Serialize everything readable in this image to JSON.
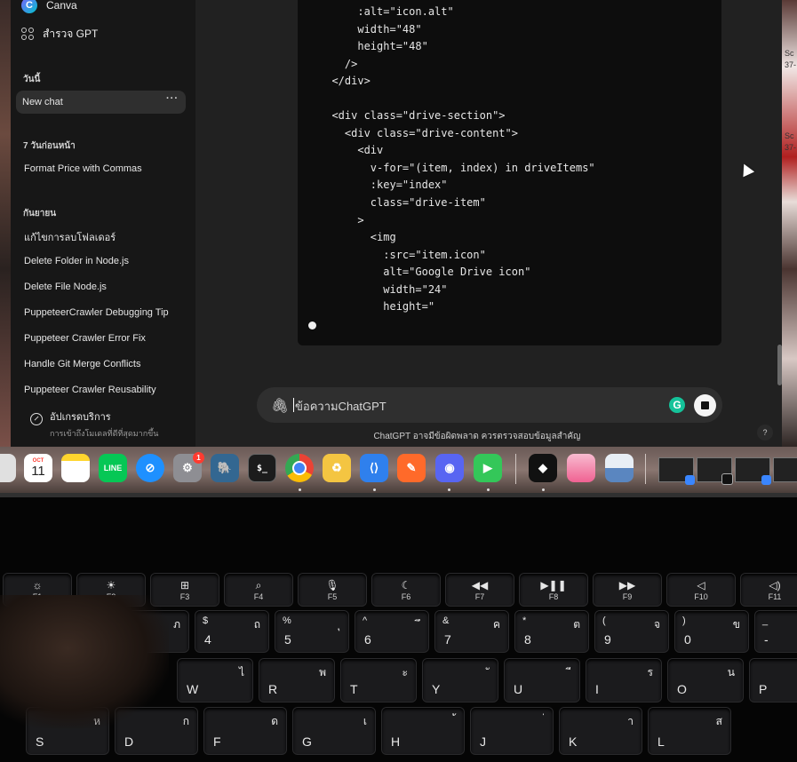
{
  "sidebar": {
    "top_items": [
      {
        "label": "Canva",
        "icon": "canva-logo-icon"
      },
      {
        "label": "สำรวจ GPT",
        "icon": "grid-icon"
      }
    ],
    "sections": [
      {
        "header": "วันนี้",
        "items": [
          "New chat"
        ]
      },
      {
        "header": "7 วันก่อนหน้า",
        "items": [
          "Format Price with Commas"
        ]
      },
      {
        "header": "กันยายน",
        "items": [
          "แก้ไขการลบโฟลเดอร์",
          "Delete Folder in Node.js",
          "Delete File Node.js",
          "PuppeteerCrawler Debugging Tip",
          "Puppeteer Crawler Error Fix",
          "Handle Git Merge Conflicts",
          "Puppeteer Crawler Reusability"
        ]
      }
    ],
    "more_label": "···",
    "upgrade": {
      "title": "อัปเกรดบริการ",
      "subtitle": "การเข้าถึงโมเดลที่ดีที่สุดมากขึ้น"
    }
  },
  "code_block": {
    "lines": [
      "      :alt=\"icon.alt\"",
      "      width=\"48\"",
      "      height=\"48\"",
      "    />",
      "  </div>",
      "",
      "  <div class=\"drive-section\">",
      "    <div class=\"drive-content\">",
      "      <div",
      "        v-for=\"(item, index) in driveItems\"",
      "        :key=\"index\"",
      "        class=\"drive-item\"",
      "      >",
      "        <img",
      "          :src=\"item.icon\"",
      "          alt=\"Google Drive icon\"",
      "          width=\"24\"",
      "          height=\""
    ]
  },
  "composer": {
    "placeholder": "ข้อความChatGPT",
    "attach_icon": "paperclip-icon",
    "grammarly_icon": "grammarly-icon",
    "stop_icon": "stop-icon"
  },
  "disclaimer": "ChatGPT อาจมีข้อผิดพลาด ควรตรวจสอบข้อมูลสำคัญ",
  "help_label": "?",
  "wallpaper_text": [
    "Sc",
    "37-",
    "Sc",
    "37-"
  ],
  "dock": {
    "apps": [
      {
        "name": "launchpad",
        "label": "",
        "color": "#e0e0e0"
      },
      {
        "name": "calendar",
        "label": "11",
        "month": "OCT",
        "color": "#ffffff"
      },
      {
        "name": "notes",
        "label": "",
        "color": "#ffd52e"
      },
      {
        "name": "line",
        "label": "LINE",
        "color": "#06c755"
      },
      {
        "name": "safari",
        "label": "⊘",
        "color": "#1e90ff"
      },
      {
        "name": "system-settings",
        "label": "⚙",
        "color": "#8e8e93",
        "badge": "1"
      },
      {
        "name": "postgres",
        "label": "🐘",
        "color": "#336791"
      },
      {
        "name": "terminal",
        "label": "$_",
        "color": "#1c1c1c"
      },
      {
        "name": "chrome",
        "label": "",
        "color": "#ffffff"
      },
      {
        "name": "recycle",
        "label": "♻",
        "color": "#f4c542"
      },
      {
        "name": "vscode",
        "label": "⟨⟩",
        "color": "#2f80ed"
      },
      {
        "name": "pen-tool",
        "label": "✎",
        "color": "#ff6a2a"
      },
      {
        "name": "discord",
        "label": "◉",
        "color": "#5865f2"
      },
      {
        "name": "facetime",
        "label": "▶",
        "color": "#34c759"
      },
      {
        "name": "unity",
        "label": "◆",
        "color": "#111111"
      },
      {
        "name": "photos",
        "label": "",
        "color": "#f06292"
      },
      {
        "name": "preview",
        "label": "",
        "color": "#e8eef5"
      }
    ]
  },
  "keyboard": {
    "fn_row": [
      {
        "icon": "☼",
        "label": "F1"
      },
      {
        "icon": "☀",
        "label": "F2"
      },
      {
        "icon": "⊞",
        "label": "F3"
      },
      {
        "icon": "⌕",
        "label": "F4"
      },
      {
        "icon": "🎙",
        "label": "F5"
      },
      {
        "icon": "☾",
        "label": "F6"
      },
      {
        "icon": "◀◀",
        "label": "F7"
      },
      {
        "icon": "▶❚❚",
        "label": "F8"
      },
      {
        "icon": "▶▶",
        "label": "F9"
      },
      {
        "icon": "◁",
        "label": "F10"
      },
      {
        "icon": "◁)",
        "label": "F11"
      }
    ],
    "number_row": [
      {
        "top": "#",
        "main": "3",
        "thai": "ภ"
      },
      {
        "top": "$",
        "main": "4",
        "thai": "ถ"
      },
      {
        "top": "%",
        "main": "5",
        "thai": "ุ"
      },
      {
        "top": "^",
        "main": "6",
        "thai": "ึ"
      },
      {
        "top": "&",
        "main": "7",
        "thai": "ค"
      },
      {
        "top": "*",
        "main": "8",
        "thai": "ต"
      },
      {
        "top": "(",
        "main": "9",
        "thai": "จ"
      },
      {
        "top": ")",
        "main": "0",
        "thai": "ข"
      },
      {
        "top": "_",
        "main": "-",
        "thai": "ช"
      }
    ],
    "q_row": [
      {
        "main": "W",
        "thai": "ไ"
      },
      {
        "main": "R",
        "thai": "พ"
      },
      {
        "main": "T",
        "thai": "ะ"
      },
      {
        "main": "Y",
        "thai": "ั"
      },
      {
        "main": "U",
        "thai": "ี"
      },
      {
        "main": "I",
        "thai": "ร"
      },
      {
        "main": "O",
        "thai": "น"
      },
      {
        "main": "P",
        "thai": "ย"
      }
    ],
    "a_row": [
      {
        "main": "S",
        "thai": "ห"
      },
      {
        "main": "D",
        "thai": "ก"
      },
      {
        "main": "F",
        "thai": "ด"
      },
      {
        "main": "G",
        "thai": "เ"
      },
      {
        "main": "H",
        "thai": "้"
      },
      {
        "main": "J",
        "thai": "่"
      },
      {
        "main": "K",
        "thai": "า"
      },
      {
        "main": "L",
        "thai": "ส"
      }
    ]
  }
}
